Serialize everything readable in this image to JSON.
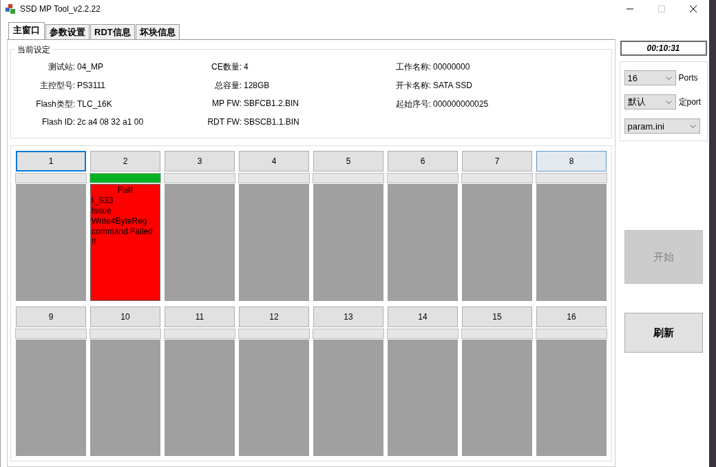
{
  "window": {
    "title": "SSD MP Tool_v2.2.22"
  },
  "tabs": [
    {
      "label": "主窗口",
      "selected": true
    },
    {
      "label": "参数设置",
      "selected": false
    },
    {
      "label": "RDT信息",
      "selected": false
    },
    {
      "label": "坏块信息",
      "selected": false
    }
  ],
  "settings": {
    "title": "当前设定",
    "columns": [
      [
        {
          "label": "测试站:",
          "value": "04_MP"
        },
        {
          "label": "主控型号:",
          "value": "PS3111"
        },
        {
          "label": "Flash类型:",
          "value": "TLC_16K"
        },
        {
          "label": "Flash ID:",
          "value": "2c a4 08 32 a1 00"
        }
      ],
      [
        {
          "label": "CE数量:",
          "value": "4"
        },
        {
          "label": "总容量:",
          "value": "128GB"
        },
        {
          "label": "MP FW:",
          "value": "SBFCB1.2.BIN"
        },
        {
          "label": "RDT FW:",
          "value": "SBSCB1.1.BIN"
        }
      ],
      [
        {
          "label": "工作名称:",
          "value": "00000000"
        },
        {
          "label": "开卡名称:",
          "value": "SATA SSD"
        },
        {
          "label": "起始序号:",
          "value": "000000000025"
        }
      ]
    ]
  },
  "ports": [
    {
      "label": "1",
      "selected": true,
      "hovered": false,
      "level": 0
    },
    {
      "label": "2",
      "selected": false,
      "hovered": false,
      "level": 1,
      "kind": "fail",
      "result_title": "Fail!",
      "result_lines": [
        "I_S33",
        "Issue",
        "Write4ByteReg",
        "command Failed",
        "!!"
      ]
    },
    {
      "label": "3",
      "selected": false,
      "hovered": false,
      "level": 0
    },
    {
      "label": "4",
      "selected": false,
      "hovered": false,
      "level": 0
    },
    {
      "label": "5",
      "selected": false,
      "hovered": false,
      "level": 0
    },
    {
      "label": "6",
      "selected": false,
      "hovered": false,
      "level": 0
    },
    {
      "label": "7",
      "selected": false,
      "hovered": false,
      "level": 0
    },
    {
      "label": "8",
      "selected": false,
      "hovered": true,
      "level": 0
    },
    {
      "label": "9",
      "selected": false,
      "hovered": false,
      "level": 0
    },
    {
      "label": "10",
      "selected": false,
      "hovered": false,
      "level": 0
    },
    {
      "label": "11",
      "selected": false,
      "hovered": false,
      "level": 0
    },
    {
      "label": "12",
      "selected": false,
      "hovered": false,
      "level": 0
    },
    {
      "label": "13",
      "selected": false,
      "hovered": false,
      "level": 0
    },
    {
      "label": "14",
      "selected": false,
      "hovered": false,
      "level": 0
    },
    {
      "label": "15",
      "selected": false,
      "hovered": false,
      "level": 0
    },
    {
      "label": "16",
      "selected": false,
      "hovered": false,
      "level": 0
    }
  ],
  "timer": "00:10:31",
  "options": [
    {
      "value": "16",
      "label": "Ports"
    },
    {
      "value": "默认",
      "label": "定port"
    },
    {
      "value": "param.ini"
    }
  ],
  "buttons": [
    {
      "label": "开始",
      "disabled": true
    },
    {
      "label": "刷新",
      "disabled": false
    }
  ]
}
